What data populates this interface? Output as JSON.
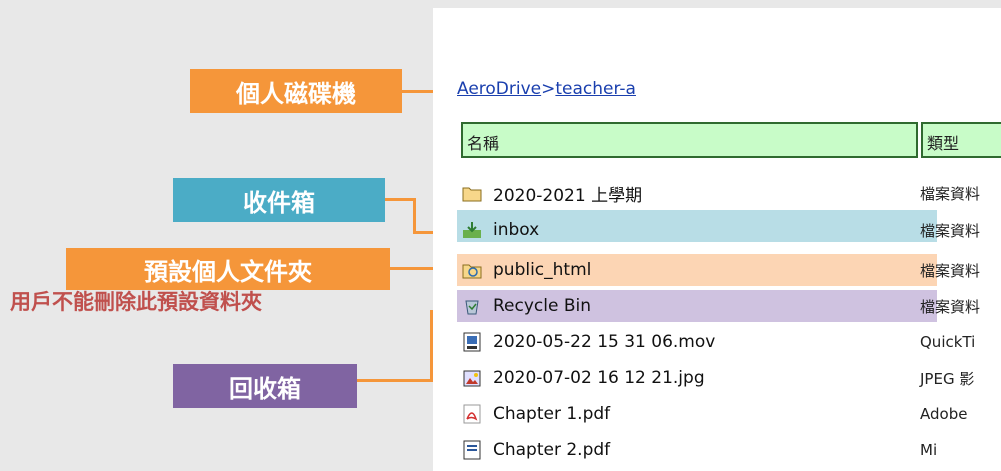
{
  "annotations": {
    "personal_drive": "個人磁碟機",
    "inbox": "收件箱",
    "default_folder": "預設個人文件夾",
    "note": "用戶不能刪除此預設資料夾",
    "recycle": "回收箱"
  },
  "breadcrumb": {
    "root": "AeroDrive",
    "separator": ">",
    "current": "teacher-a"
  },
  "columns": {
    "name": "名稱",
    "type": "類型"
  },
  "files": [
    {
      "name": "2020-2021 上學期",
      "type": "檔案資料",
      "icon": "folder-icon"
    },
    {
      "name": "inbox",
      "type": "檔案資料",
      "icon": "inbox-icon"
    },
    {
      "name": "public_html",
      "type": "檔案資料",
      "icon": "web-folder-icon"
    },
    {
      "name": "Recycle Bin",
      "type": "檔案資料",
      "icon": "recycle-bin-icon"
    },
    {
      "name": "2020-05-22 15 31 06.mov",
      "type": "QuickTi",
      "icon": "video-file-icon"
    },
    {
      "name": "2020-07-02 16 12 21.jpg",
      "type": "JPEG 影",
      "icon": "image-file-icon"
    },
    {
      "name": "Chapter 1.pdf",
      "type": "Adobe ",
      "icon": "pdf-file-icon"
    },
    {
      "name": "Chapter 2.pdf",
      "type": "Mi",
      "icon": "doc-file-icon"
    }
  ],
  "colors": {
    "accent_orange": "#f5963a",
    "inbox_highlight": "#b8dde6",
    "public_html_highlight": "#fcd5b4",
    "recycle_highlight": "#cfc2e0",
    "header_green": "#c8fcc8"
  }
}
